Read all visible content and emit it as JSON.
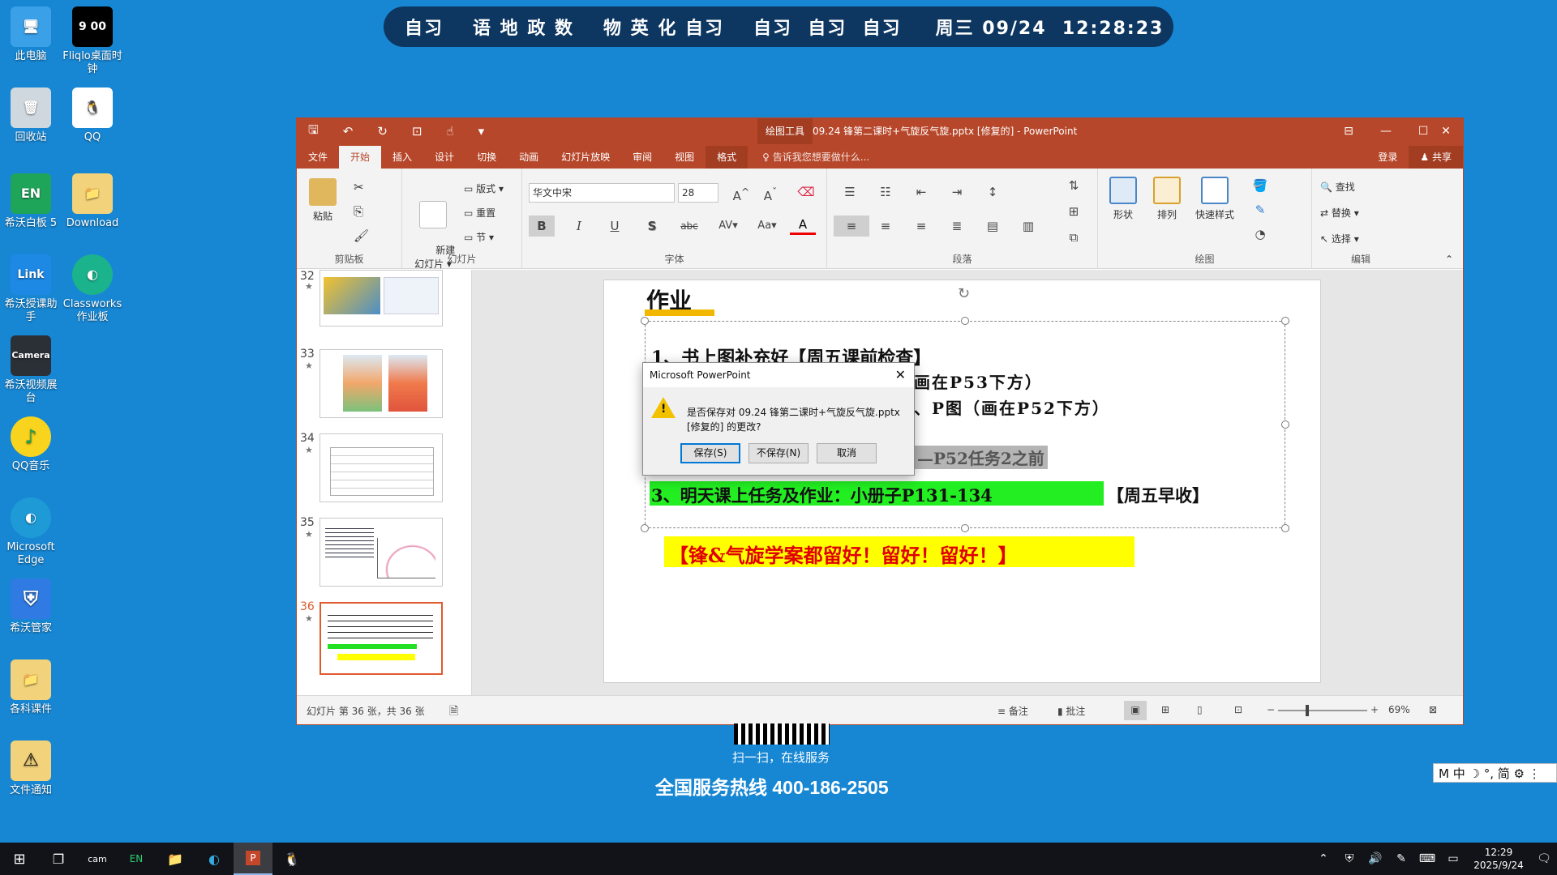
{
  "desktop": {
    "icons": [
      {
        "label": "此电脑",
        "glyph": "🖥"
      },
      {
        "label": "Fliqlo桌面时钟",
        "glyph": "9 00"
      },
      {
        "label": "回收站",
        "glyph": "🗑"
      },
      {
        "label": "QQ",
        "glyph": "🐧"
      },
      {
        "label": "希沃白板 5",
        "glyph": "EN"
      },
      {
        "label": "Download",
        "glyph": "📁"
      },
      {
        "label": "希沃授课助手",
        "glyph": "Link"
      },
      {
        "label": "Classworks作业板",
        "glyph": "◐"
      },
      {
        "label": "希沃视频展台",
        "glyph": "Camera"
      },
      {
        "label": "QQ音乐",
        "glyph": "♪"
      },
      {
        "label": "Microsoft Edge",
        "glyph": "◐"
      },
      {
        "label": "希沃管家",
        "glyph": "⛨"
      },
      {
        "label": "各科课件",
        "glyph": "📁"
      },
      {
        "label": "文件通知",
        "glyph": "⚠"
      }
    ]
  },
  "schedule": {
    "seg1": "自习",
    "seg2": "语 地 政 数",
    "seg3": "物 英 化 自习",
    "seg4": "自习  自习  自习",
    "clock": "周三 09/24  12:28:23"
  },
  "ppt": {
    "quick_access": {
      "save": "🖫",
      "undo": "↶",
      "redo": "↻",
      "present": "⊡",
      "touch": "☝",
      "more": "▾"
    },
    "context_label": "绘图工具",
    "doc_title": "09.24 锋第二课时+气旋反气旋.pptx [修复的] - PowerPoint",
    "window_buttons": {
      "ribbon_opts": "⊟",
      "min": "—",
      "max": "☐",
      "close": "✕"
    },
    "tabs": [
      "文件",
      "开始",
      "插入",
      "设计",
      "切换",
      "动画",
      "幻灯片放映",
      "审阅",
      "视图",
      "格式"
    ],
    "tell_me": "♀ 告诉我您想要做什么...",
    "login": "登录",
    "share": "♟ 共享",
    "ribbon": {
      "clipboard": {
        "paste": "粘贴",
        "group": "剪贴板"
      },
      "slides": {
        "new_slide": "新建\n幻灯片 ▾",
        "layout": "版式 ▾",
        "reset": "重置",
        "section": "节 ▾",
        "group": "幻灯片"
      },
      "font": {
        "font_name": "华文中宋",
        "font_size": "28",
        "group": "字体",
        "bold": "B",
        "italic": "I",
        "underline": "U",
        "shadow": "S",
        "strike": "abc",
        "spacing": "AV▾",
        "case": "Aa▾",
        "color": "A"
      },
      "paragraph": {
        "group": "段落"
      },
      "drawing": {
        "shapes": "形状",
        "arrange": "排列",
        "quick_styles": "快速样式",
        "group": "绘图"
      },
      "editing": {
        "find": "查找",
        "replace": "替换 ▾",
        "select": "选择 ▾",
        "group": "编辑"
      }
    },
    "thumbnails": [
      {
        "num": "32",
        "star": "★"
      },
      {
        "num": "33",
        "star": "★"
      },
      {
        "num": "34",
        "star": "★"
      },
      {
        "num": "35",
        "star": "★"
      },
      {
        "num": "36",
        "star": "★"
      }
    ],
    "slide": {
      "title": "作业",
      "line1": "1、书上图补充好【周五课前检查】",
      "line1b": "画在P53下方）",
      "line2b": "、P图（画在P52下方）",
      "line2c": "—P52任务2之前",
      "line3": "3、明天课上任务及作业：小册子P131-134",
      "line3_tail": "【周五早收】",
      "line4": "【锋&气旋学案都留好！留好！留好！】"
    },
    "status": {
      "slide_count": "幻灯片 第 36 张，共 36 张",
      "notes": "≡ 备注",
      "comments": "▮ 批注",
      "zoom": "69%"
    }
  },
  "dialog": {
    "title": "Microsoft PowerPoint",
    "message": "是否保存对 09.24 锋第二课时+气旋反气旋.pptx [修复的] 的更改?",
    "save": "保存(S)",
    "dont_save": "不保存(N)",
    "cancel": "取消"
  },
  "ad": {
    "scan": "扫一扫，在线服务",
    "hotline": "全国服务热线 400-186-2505"
  },
  "ime": "M 中 ☽ °, 简 ⚙ ⋮",
  "taskbar": {
    "time": "12:29",
    "date": "2025/9/24"
  }
}
